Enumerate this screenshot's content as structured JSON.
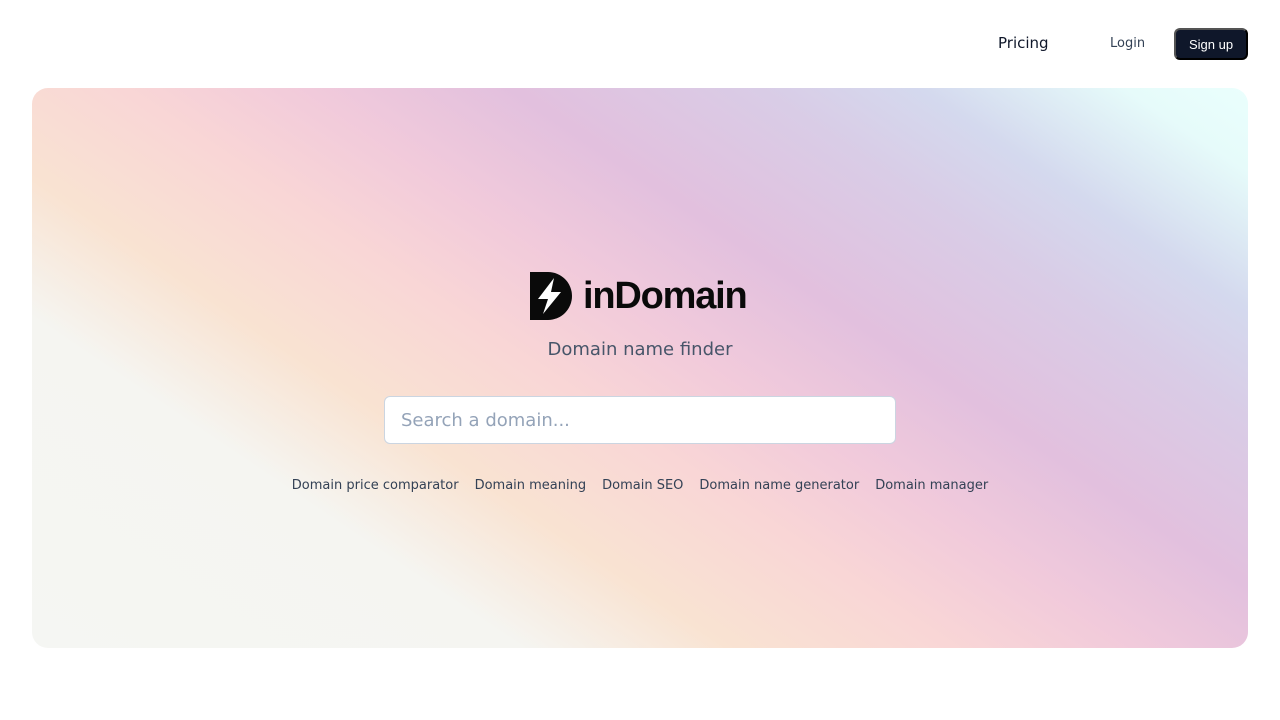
{
  "nav": {
    "pricing": "Pricing",
    "login": "Login",
    "signup": "Sign up"
  },
  "brand": {
    "name": "inDomain",
    "logo_icon": "bolt-d-logo-icon",
    "tagline": "Domain name finder"
  },
  "search": {
    "placeholder": "Search a domain...",
    "value": ""
  },
  "links": [
    "Domain price comparator",
    "Domain meaning",
    "Domain SEO",
    "Domain name generator",
    "Domain manager"
  ],
  "colors": {
    "primary_button": "#0f172a",
    "text_muted": "#475569",
    "input_border": "#cbd5e1",
    "gradient_stops": [
      "#f5f6f3",
      "#f9e3d2",
      "#f9d6d6",
      "#e2c0de",
      "#d4d9ee",
      "#eafffd"
    ]
  }
}
